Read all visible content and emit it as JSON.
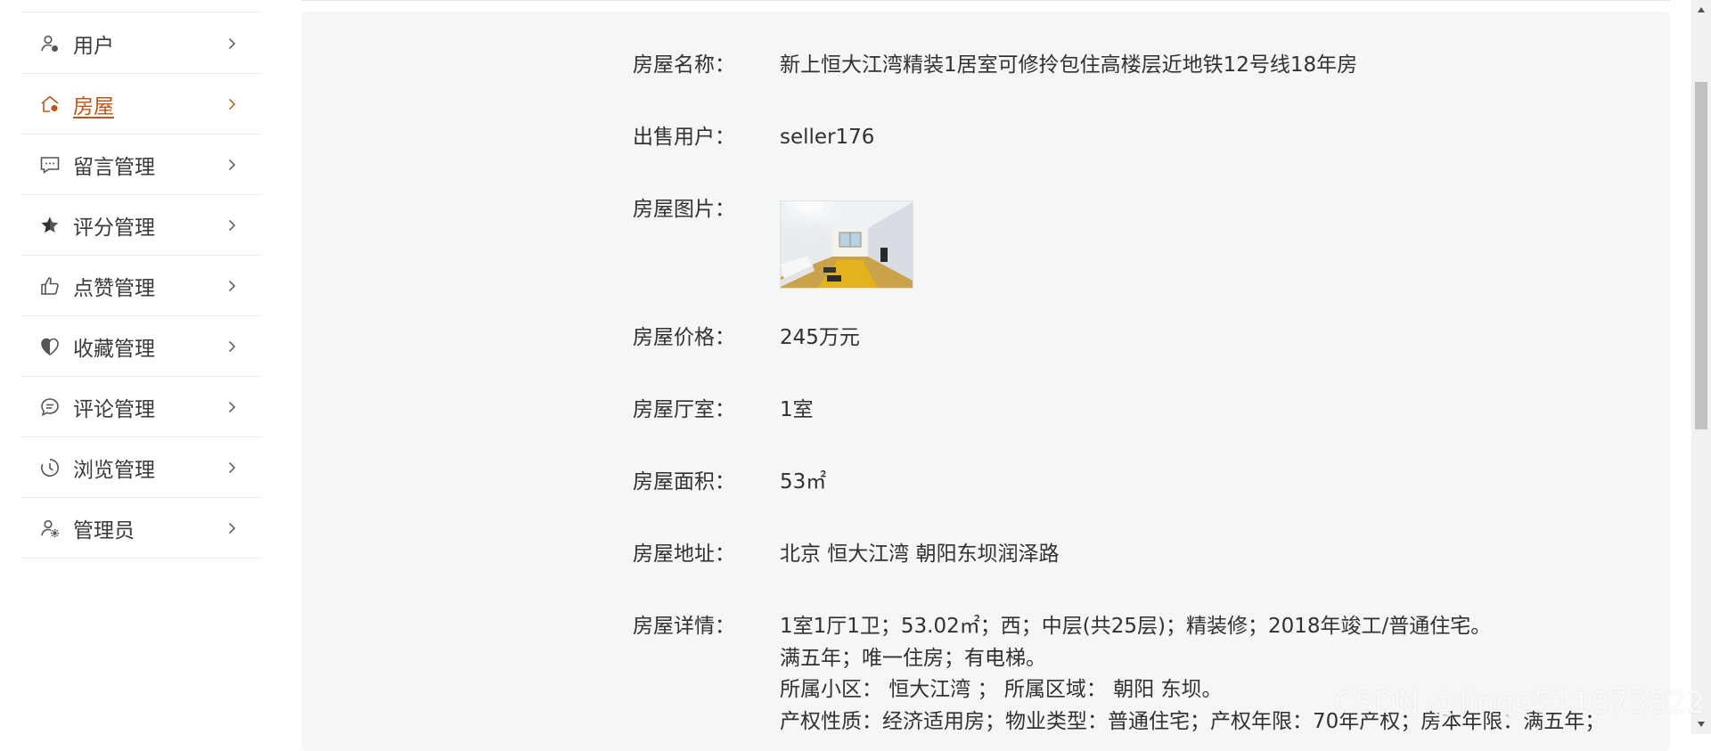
{
  "sidebar": {
    "items": [
      {
        "icon": "user-icon",
        "label": "用户",
        "active": false
      },
      {
        "icon": "house-icon",
        "label": "房屋",
        "active": true
      },
      {
        "icon": "message-icon",
        "label": "留言管理",
        "active": false
      },
      {
        "icon": "star-icon",
        "label": "评分管理",
        "active": false
      },
      {
        "icon": "thumbs-up-icon",
        "label": "点赞管理",
        "active": false
      },
      {
        "icon": "heart-shield-icon",
        "label": "收藏管理",
        "active": false
      },
      {
        "icon": "comment-icon",
        "label": "评论管理",
        "active": false
      },
      {
        "icon": "clock-icon",
        "label": "浏览管理",
        "active": false
      },
      {
        "icon": "admin-user-icon",
        "label": "管理员",
        "active": false
      }
    ],
    "accent_color": "#c2551a"
  },
  "detail": {
    "name_label": "房屋名称：",
    "name_value": "新上恒大江湾精装1居室可修拎包住高楼层近地铁12号线18年房",
    "seller_label": "出售用户：",
    "seller_value": "seller176",
    "image_label": "房屋图片：",
    "price_label": "房屋价格：",
    "price_value": "245万元",
    "rooms_label": "房屋厅室：",
    "rooms_value": "1室",
    "area_label": "房屋面积：",
    "area_value": "53㎡",
    "address_label": "房屋地址：",
    "address_value": "北京 恒大江湾 朝阳东坝润泽路",
    "details_label": "房屋详情：",
    "details_lines": [
      "1室1厅1卫；53.02㎡；西；中层(共25层)；精装修；2018年竣工/普通住宅。",
      "满五年；唯一住房；有电梯。",
      "所属小区： 恒大江湾 ； 所属区域： 朝阳 东坝。",
      "产权性质：经济适用房；物业类型：普通住宅；产权年限：70年产权；房本年限：满五年；"
    ]
  },
  "watermark": "CSDN @linge511873822"
}
